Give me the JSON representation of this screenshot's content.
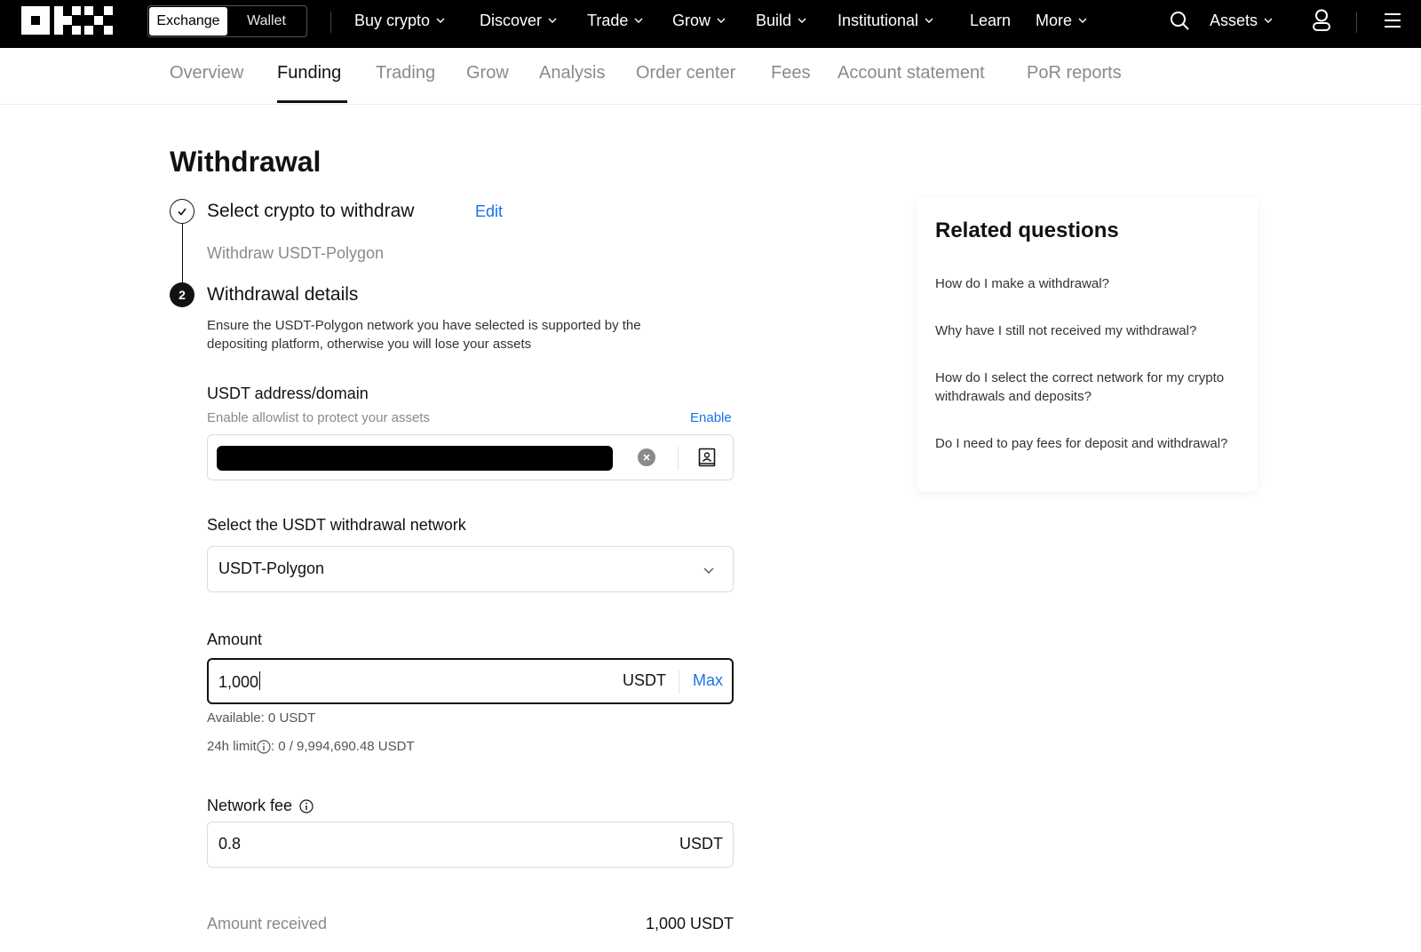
{
  "topnav": {
    "toggle": {
      "exchange": "Exchange",
      "wallet": "Wallet"
    },
    "items": [
      {
        "label": "Buy crypto",
        "dropdown": true
      },
      {
        "label": "Discover",
        "dropdown": true
      },
      {
        "label": "Trade",
        "dropdown": true
      },
      {
        "label": "Grow",
        "dropdown": true
      },
      {
        "label": "Build",
        "dropdown": true
      },
      {
        "label": "Institutional",
        "dropdown": true
      },
      {
        "label": "Learn",
        "dropdown": false
      },
      {
        "label": "More",
        "dropdown": true
      }
    ],
    "assets_label": "Assets",
    "icons": {
      "search": "search-icon",
      "user": "user-icon",
      "menu": "hamburger-icon"
    }
  },
  "subnav": {
    "tabs": [
      "Overview",
      "Funding",
      "Trading",
      "Grow",
      "Analysis",
      "Order center",
      "Fees",
      "Account statement",
      "PoR reports"
    ],
    "active_tab": "Funding"
  },
  "page": {
    "title": "Withdrawal",
    "step1": {
      "title": "Select crypto to withdraw",
      "edit": "Edit",
      "subtitle": "Withdraw USDT-Polygon",
      "status_icon": "check-icon"
    },
    "step2": {
      "number": "2",
      "title": "Withdrawal details",
      "warning": "Ensure the USDT-Polygon network you have selected is supported by the depositing platform, otherwise you will lose your assets"
    },
    "address": {
      "label": "USDT address/domain",
      "hint": "Enable allowlist to protect your assets",
      "enable": "Enable"
    },
    "network": {
      "label": "Select the USDT withdrawal network",
      "value": "USDT-Polygon"
    },
    "amount": {
      "label": "Amount",
      "value": "1,000",
      "unit": "USDT",
      "max": "Max",
      "available": "Available: 0 USDT",
      "limit_label": "24h limit",
      "limit_value": ": 0 / 9,994,690.48 USDT"
    },
    "fee": {
      "label": "Network fee",
      "value": "0.8",
      "unit": "USDT"
    },
    "received": {
      "label": "Amount received",
      "value": "1,000 USDT"
    }
  },
  "related": {
    "title": "Related questions",
    "questions": [
      "How do I make a withdrawal?",
      "Why have I still not received my withdrawal?",
      "How do I select the correct network for my crypto withdrawals and deposits?",
      "Do I need to pay fees for deposit and withdrawal?"
    ]
  }
}
